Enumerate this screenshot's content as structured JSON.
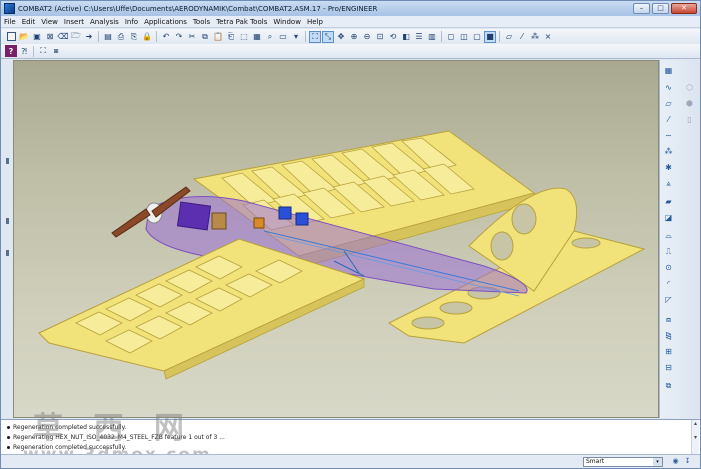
{
  "window": {
    "title": "COMBAT2 (Active) C:\\Users\\Uffe\\Documents\\AERODYNAMIK\\Combat\\COMBAT2.ASM.17 - Pro/ENGINEER",
    "minimize": "–",
    "maximize": "□",
    "close": "✕"
  },
  "menu": [
    "File",
    "Edit",
    "View",
    "Insert",
    "Analysis",
    "Info",
    "Applications",
    "Tools",
    "Tetra Pak Tools",
    "Window",
    "Help"
  ],
  "messages": [
    "Regeneration completed successfully.",
    "Regenerating HEX_NUT_ISO_4032_M4_STEEL_FZB feature 1 out of 3 ...",
    "Regeneration completed successfully."
  ],
  "status": {
    "filter_value": "Smart",
    "filter_arrow": "▾"
  },
  "watermark": {
    "chinese": "草 西 网",
    "url": "www.3dmox.com"
  },
  "colors": {
    "wing": "#f2e27a",
    "wing_edge": "#b8a23a",
    "fuselage": "#9a6fd6",
    "viewport_top": "#a9a890",
    "viewport_bottom": "#d8d8c8"
  },
  "icons": {
    "toolbar1": [
      "new-icon",
      "open-icon",
      "save-icon",
      "close-window-icon",
      "erase-icon",
      "folder-icon",
      "arrow-right-icon",
      "regenerate-icon",
      "print-icon",
      "printer-icon",
      "lock-icon",
      "undo-icon",
      "redo-icon",
      "cut-icon",
      "copy-icon",
      "paste-icon",
      "paste-special-icon",
      "select-icon",
      "table-icon",
      "find-icon",
      "window-select-icon",
      "dropdown-icon",
      "repaint-icon",
      "orient-icon",
      "spin-center-icon",
      "zoom-in-icon",
      "zoom-out-icon",
      "refit-icon",
      "reorient-icon",
      "saved-views-icon",
      "layers-icon",
      "view-manager-icon",
      "shading-icon",
      "hidden-line-icon",
      "no-hidden-icon",
      "wireframe-icon",
      "datum-plane-icon",
      "datum-axis-icon",
      "datum-point-icon"
    ],
    "toolbar2": [
      "help-icon",
      "whats-this-icon",
      "model-tree-icon",
      "display-style-icon"
    ]
  }
}
